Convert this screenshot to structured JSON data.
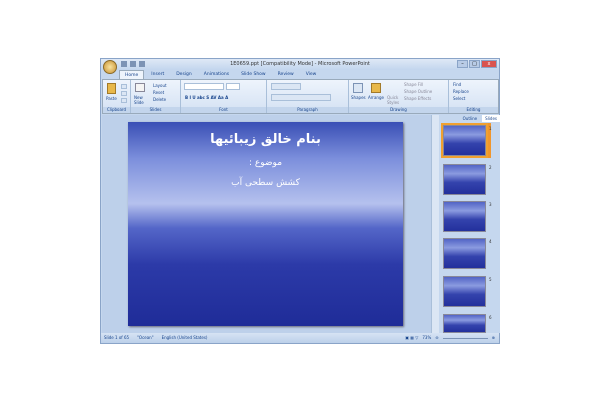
{
  "window": {
    "title": "1E0659.ppt [Compatibility Mode] - Microsoft PowerPoint"
  },
  "tabs": [
    "Home",
    "Insert",
    "Design",
    "Animations",
    "Slide Show",
    "Review",
    "View"
  ],
  "ribbon": {
    "clipboard": {
      "label": "Clipboard",
      "paste": "Paste"
    },
    "slides": {
      "label": "Slides",
      "new_slide": "New Slide",
      "layout": "Layout",
      "reset": "Reset",
      "delete": "Delete"
    },
    "font": {
      "label": "Font"
    },
    "paragraph": {
      "label": "Paragraph"
    },
    "drawing": {
      "label": "Drawing",
      "shapes": "Shapes",
      "arrange": "Arrange",
      "quick_styles": "Quick Styles",
      "shape_fill": "Shape Fill",
      "shape_outline": "Shape Outline",
      "shape_effects": "Shape Effects"
    },
    "editing": {
      "label": "Editing",
      "find": "Find",
      "replace": "Replace",
      "select": "Select"
    }
  },
  "slide": {
    "title": "بنام خالق زیبائیها",
    "subtitle": "موضوع :",
    "body": "کشش سطحی آب"
  },
  "pane": {
    "tabs": [
      "Outline",
      "Slides"
    ],
    "thumbnails": [
      "1",
      "2",
      "3",
      "4",
      "5",
      "6"
    ]
  },
  "status": {
    "slide": "Slide 1 of 65",
    "theme": "\"Ocean\"",
    "language": "English (United States)",
    "zoom": "73%"
  }
}
